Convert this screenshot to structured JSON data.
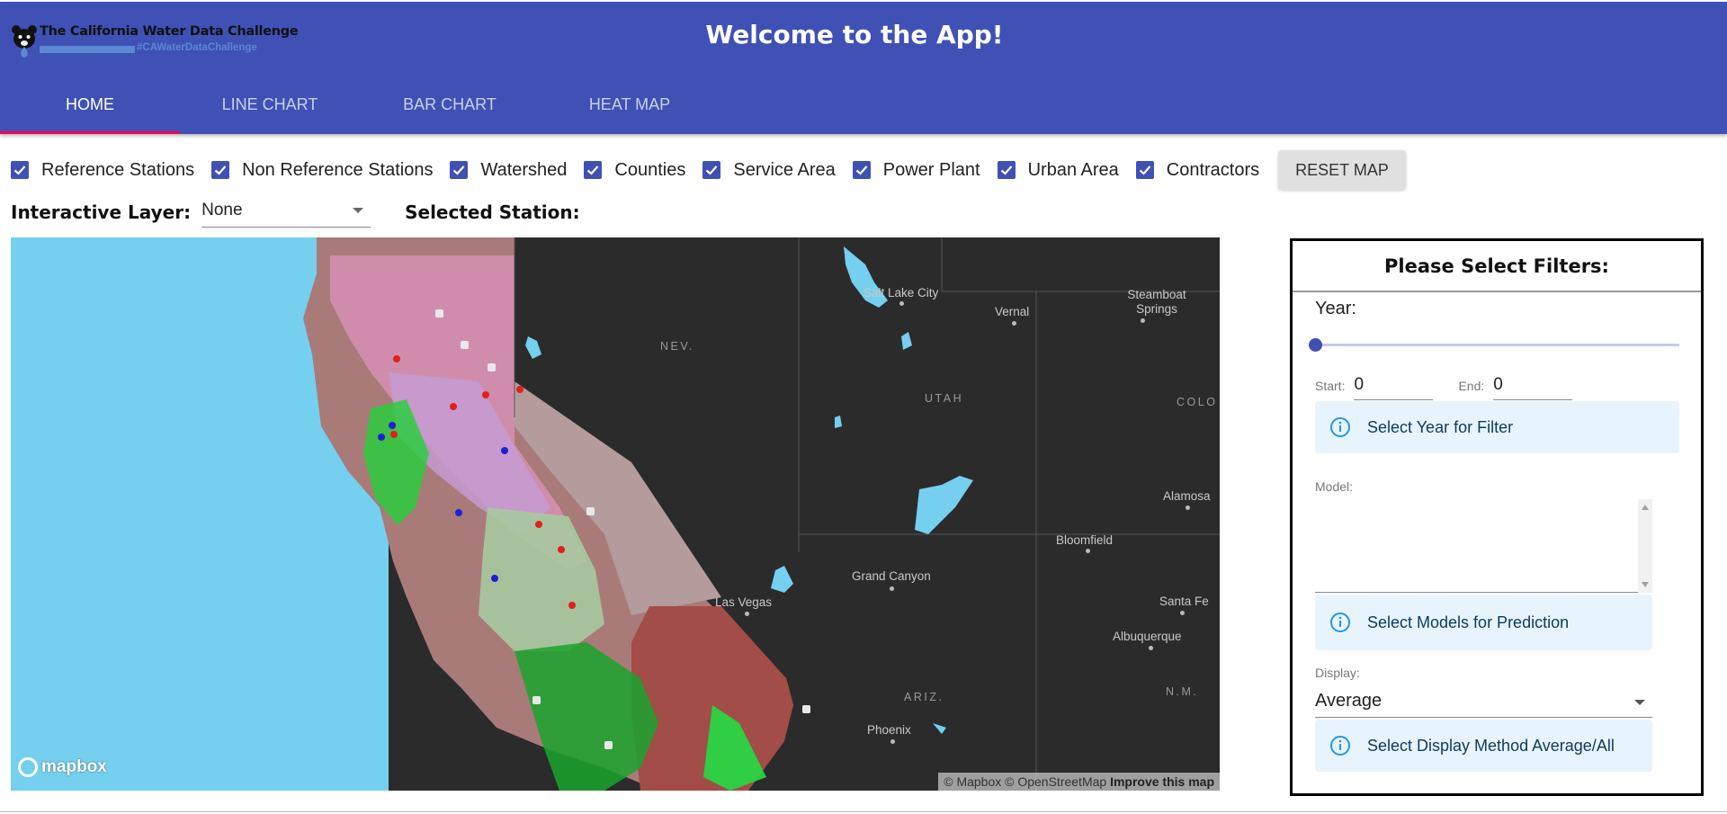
{
  "header": {
    "logo_title": "The California Water Data Challenge",
    "logo_hashtag": "#CAWaterDataChallenge",
    "app_title": "Welcome to the App!",
    "brand_color": "#3f51b5",
    "tabs": [
      {
        "label": "HOME",
        "active": true
      },
      {
        "label": "LINE CHART",
        "active": false
      },
      {
        "label": "BAR CHART",
        "active": false
      },
      {
        "label": "HEAT MAP",
        "active": false
      }
    ]
  },
  "layers": {
    "items": [
      {
        "label": "Reference Stations",
        "checked": true
      },
      {
        "label": "Non Reference Stations",
        "checked": true
      },
      {
        "label": "Watershed",
        "checked": true
      },
      {
        "label": "Counties",
        "checked": true
      },
      {
        "label": "Service Area",
        "checked": true
      },
      {
        "label": "Power Plant",
        "checked": true
      },
      {
        "label": "Urban Area",
        "checked": true
      },
      {
        "label": "Contractors",
        "checked": true
      }
    ],
    "reset_label": "RESET MAP"
  },
  "interactive": {
    "label": "Interactive Layer:",
    "value": "None",
    "selected_station_label": "Selected Station:"
  },
  "map": {
    "labels": {
      "nev": "NEV.",
      "utah": "UTAH",
      "colo": "COLO",
      "ariz": "ARIZ.",
      "nm": "N.M.",
      "salt_lake": "Salt Lake City",
      "vernal": "Vernal",
      "steamboat": "Steamboat Springs",
      "las_vegas": "Las Vegas",
      "grand_canyon": "Grand Canyon",
      "bloomfield": "Bloomfield",
      "alamosa": "Alamosa",
      "santa_fe": "Santa Fe",
      "albuquerque": "Albuquerque",
      "phoenix": "Phoenix"
    },
    "mapbox_logo": "mapbox",
    "attribution": "© Mapbox © OpenStreetMap",
    "improve": "Improve this map"
  },
  "filters": {
    "title": "Please Select Filters:",
    "year_label": "Year:",
    "year_slider_value": 0,
    "start_label": "Start:",
    "start_value": "0",
    "end_label": "End:",
    "end_value": "0",
    "year_info": "Select Year for Filter",
    "model_label": "Model:",
    "model_info": "Select Models for Prediction",
    "display_label": "Display:",
    "display_value": "Average",
    "display_info": "Select Display Method Average/All"
  }
}
